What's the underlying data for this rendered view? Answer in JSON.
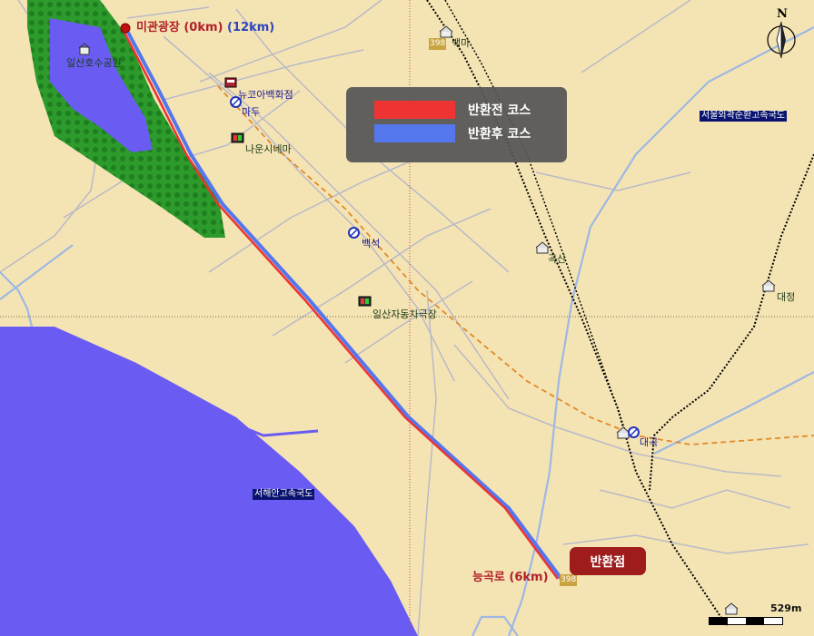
{
  "colors": {
    "route_before": "#ee3333",
    "route_after": "#5577ee",
    "water": "#6a5cf2",
    "park": "#2c9b2c",
    "land": "#f5e4b3",
    "road": "#b8b8d0"
  },
  "legend": {
    "before_label": "반환전 코스",
    "after_label": "반환후 코스"
  },
  "route": {
    "start_label": "미관광장 (0km)",
    "start_label_extra": "(12km)",
    "end_label": "능곡로 (6km)",
    "turnaround_label": "반환점"
  },
  "places": {
    "park": "일산호수공원",
    "newcore": "뉴코아백화점",
    "madu": "마두",
    "cinema": "나운시네마",
    "baekseok_station": "백석",
    "baekma": "백마",
    "gogsan": "곡산",
    "daegok": "대곡",
    "daejeong": "대정",
    "theater": "일산자동차극장"
  },
  "highways": {
    "seoul_ring": "서울외곽순환고속국도",
    "west_coast": "서해안고속국도"
  },
  "road_numbers": {
    "r1": "398",
    "r2": "398"
  },
  "compass_label": "N",
  "scale_label": "529m"
}
